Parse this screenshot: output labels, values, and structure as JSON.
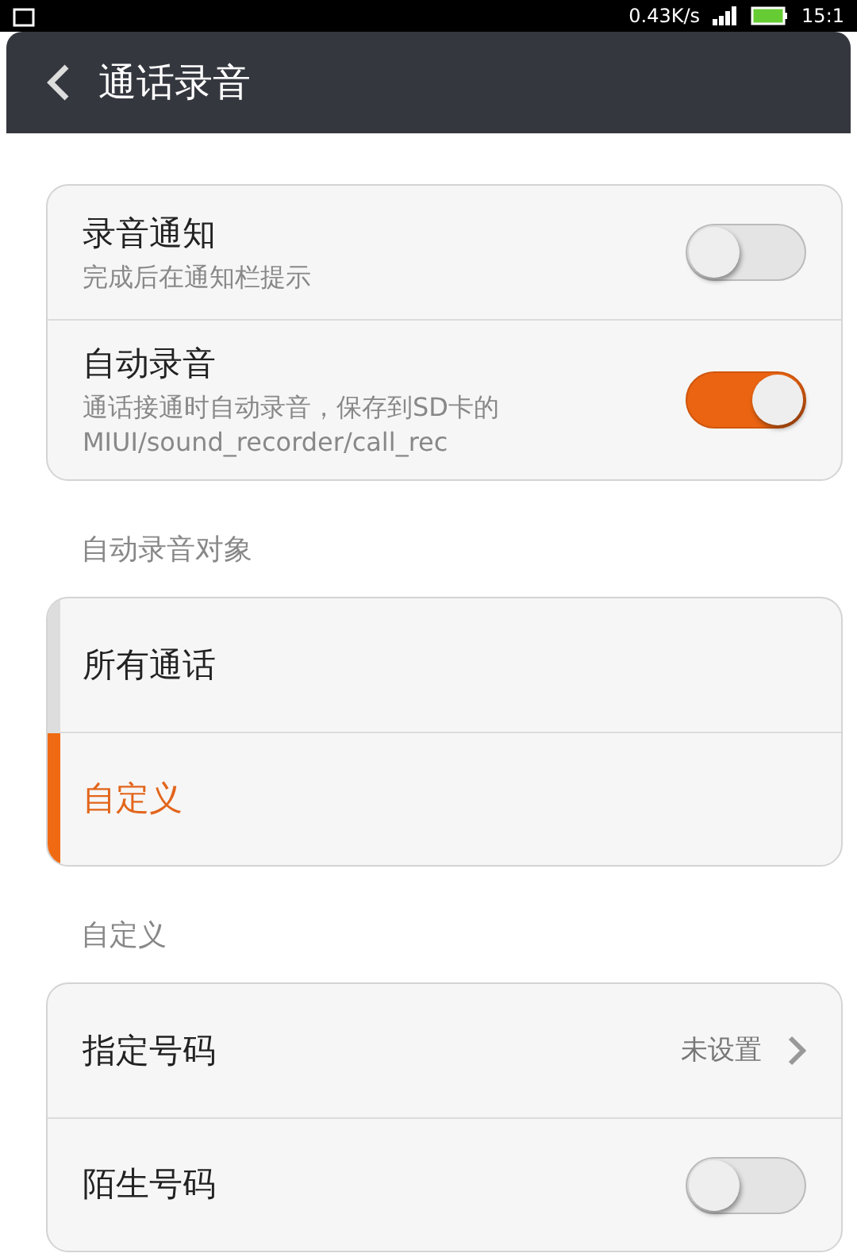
{
  "status_bar": {
    "net_speed": "0.43K/s",
    "time": "15:1"
  },
  "header": {
    "title": "通话录音"
  },
  "sections": [
    {
      "items": [
        {
          "kind": "toggle",
          "title": "录音通知",
          "subtitle": "完成后在通知栏提示",
          "on": false
        },
        {
          "kind": "toggle",
          "title": "自动录音",
          "subtitle": "通话接通时自动录音，保存到SD卡的MIUI/sound_recorder/call_rec",
          "on": true
        }
      ]
    },
    {
      "label": "自动录音对象",
      "items": [
        {
          "kind": "choice",
          "title": "所有通话",
          "selected": false
        },
        {
          "kind": "choice",
          "title": "自定义",
          "selected": true
        }
      ]
    },
    {
      "label": "自定义",
      "items": [
        {
          "kind": "link",
          "title": "指定号码",
          "value": "未设置"
        },
        {
          "kind": "toggle",
          "title": "陌生号码",
          "on": false
        }
      ]
    }
  ]
}
